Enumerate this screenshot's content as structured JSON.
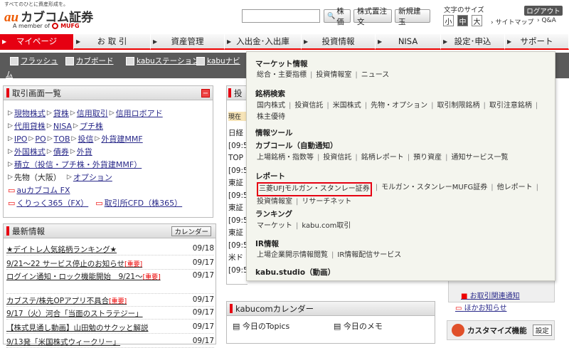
{
  "header": {
    "tagline": "すべてのひとに資産形成を。",
    "logo_brand": "au",
    "logo_name": "カブコム証券",
    "member_text": "A member of",
    "mufg": "MUFG",
    "btn_price": "株価",
    "btn_order": "株式置注文",
    "btn_new": "新規建玉",
    "fontsize_label": "文字のサイズ",
    "fs_small": "小",
    "fs_mid": "中",
    "fs_large": "大",
    "logout": "ログアウト",
    "sitemap": "サイトマップ",
    "qa": "Q&A"
  },
  "nav": [
    {
      "label": "マイページ"
    },
    {
      "label": "お 取 引"
    },
    {
      "label": "資産管理"
    },
    {
      "label": "入出金･入出庫"
    },
    {
      "label": "投資情報"
    },
    {
      "label": "NISA"
    },
    {
      "label": "設定･申込"
    },
    {
      "label": "サポート"
    }
  ],
  "subnav": {
    "items": [
      "フラッシュ",
      "カブボード",
      "kabuステーション",
      "kabuナビ"
    ],
    "more": "ム"
  },
  "trade_panel": {
    "title": "取引画面一覧",
    "rows": [
      [
        "現物株式",
        "貸株",
        "信用取引",
        "信用ロボアド"
      ],
      [
        "代用貸株",
        "NISA",
        "プチ株"
      ],
      [
        "IPO",
        "PO",
        "TOB",
        "投信",
        "外貨建MMF"
      ],
      [
        "外国株式",
        "債券",
        "外貨"
      ],
      [
        "積立（投信・プチ株・外貨建MMF）"
      ],
      [
        "先物（大阪）",
        "オプション"
      ],
      [
        "auカブコム FX"
      ],
      [
        "くりっく365（FX）",
        "取引所CFD（株365）"
      ]
    ]
  },
  "news_panel": {
    "title": "最新情報",
    "calendar": "カレンダー",
    "important": "[重要]",
    "items": [
      {
        "text": "★デイトレ人気銘柄ランキング★",
        "date": "09/18"
      },
      {
        "text": "9/21～22 サービス停止のお知らせ",
        "date": "09/17",
        "imp": true
      },
      {
        "text": "ログイン通知・ロック機能開始　9/21～",
        "date": "09/17",
        "imp": true
      },
      {
        "text": "カブステ/株先OPアプリ不具合",
        "date": "09/17",
        "imp": true
      },
      {
        "text": "9/17（火）河合「当面のストラテジー」",
        "date": "09/17"
      },
      {
        "text": "【株式見通し動画】山田勉のサクッと解説",
        "date": "09/17"
      },
      {
        "text": "9/13発「米国株式ウィークリー」",
        "date": "09/17"
      }
    ]
  },
  "mid": {
    "tab": "投",
    "now": "現在",
    "rows": [
      "日経",
      "[09:5",
      "TOP",
      "[09:5",
      "東証",
      "[09:5",
      "東証",
      "[09:5",
      "東証",
      "[09:5",
      "米ド",
      "[09:5"
    ],
    "calendar_title": "kabucomカレンダー",
    "today_topics": "今日のTopics",
    "today_memo": "今日のメモ"
  },
  "right": {
    "notice": "お取引関連通知",
    "other": "ほかお知らせ",
    "customize": "カスタマイズ機能",
    "settings": "設定"
  },
  "dropdown": {
    "sections": [
      {
        "title": "マーケット情報",
        "items": [
          "総合・主要指標",
          "投資情報室",
          "ニュース"
        ]
      },
      {
        "title": "銘柄検索",
        "items": [
          "国内株式",
          "投資信託",
          "米国株式",
          "先物・オプション",
          "取引制限銘柄",
          "取引注意銘柄",
          "株主優待"
        ]
      },
      {
        "title": "情報ツール",
        "items": []
      },
      {
        "title": "カブコール（自動通知）",
        "items": [
          "上場銘柄・指数等",
          "投資信託",
          "銘柄レポート",
          "預り資産",
          "通知サービス一覧"
        ]
      },
      {
        "title": "レポート",
        "items": [
          "三菱UFJモルガン・スタンレー証券",
          "モルガン・スタンレーMUFG証券",
          "他レポート",
          "投資情報室",
          "リサーチネット"
        ]
      },
      {
        "title": "ランキング",
        "items": [
          "マーケット",
          "kabu.com取引"
        ]
      },
      {
        "title": "IR情報",
        "items": [
          "上場企業開示情報閲覧",
          "IR情報配信サービス"
        ]
      },
      {
        "title": "kabu.studio（動画）",
        "items": []
      }
    ]
  }
}
